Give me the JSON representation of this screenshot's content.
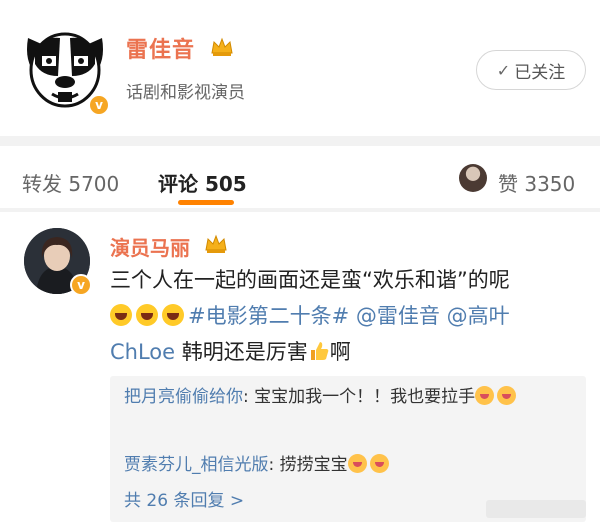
{
  "post_author": {
    "name": "雷佳音",
    "description": "话剧和影视演员",
    "follow_label": "已关注"
  },
  "tabs": {
    "repost": "转发 5700",
    "comments": "评论 505",
    "likes": "赞 3350"
  },
  "comment": {
    "author": "演员马丽",
    "line1": "三个人在一起的画面还是蛮“欢乐和谐”的呢",
    "hashtag": "#电影第二十条#",
    "mention1": "@雷佳音",
    "mention2": "@高叶",
    "mention3_tail": "ChLoe",
    "line3_text": "韩明还是厉害",
    "line3_end": "啊"
  },
  "replies": [
    {
      "name": "把月亮偷偷给你",
      "text": ": 宝宝加我一个！！我也要拉手"
    },
    {
      "name": "贾素芬儿_相信光版",
      "text": ": 捞捞宝宝"
    }
  ],
  "more_replies": "共 26 条回复 >",
  "colors": {
    "name_orange": "#eb7350",
    "link_blue": "#507daf",
    "tab_indicator": "#ff8200",
    "verify_badge": "#f6a623"
  },
  "icons": [
    "crown-icon",
    "verify-badge-icon",
    "check-icon",
    "emoji-grin-icon",
    "thumbs-up-icon"
  ]
}
